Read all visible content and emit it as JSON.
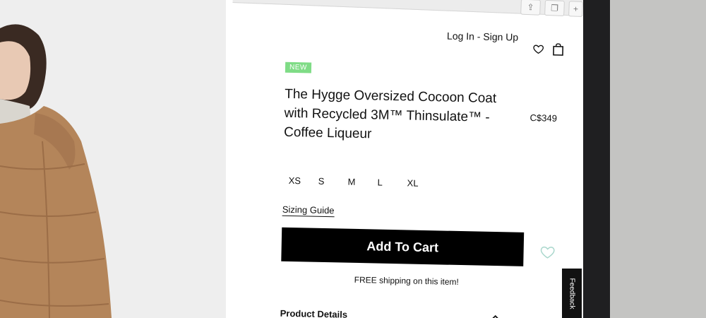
{
  "header": {
    "account_link": "Log In - Sign Up"
  },
  "product": {
    "badge": "NEW",
    "title": "The Hygge Oversized Cocoon Coat with Recycled 3M™ Thinsulate™ - Coffee Liqueur",
    "price": "C$349",
    "sizes": [
      "XS",
      "S",
      "M",
      "L",
      "XL"
    ],
    "sizing_guide": "Sizing Guide",
    "add_to_cart": "Add To Cart",
    "shipping_note": "FREE shipping on this item!",
    "details_label": "Product Details"
  },
  "feedback_tab": "Feedback",
  "colors": {
    "badge": "#7fdc86",
    "cart_button": "#000000",
    "coat": "#b4855a"
  }
}
